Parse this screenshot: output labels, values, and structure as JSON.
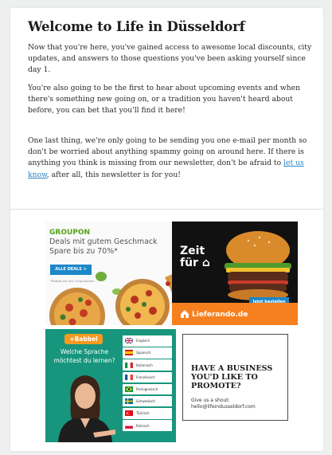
{
  "newsletter": {
    "title": "Welcome to Life in Düsseldorf",
    "p1": "Now that you're here, you've gained access to awesome local discounts, city updates, and answers to those questions you've been asking yourself since day 1.",
    "p2": "You're also going to be the first to hear about upcoming events and when there's something new going on, or a tradition you haven't heard about before, you can bet that you'll find it here!",
    "p3_before": "One last thing, we're only going to be sending you one e-mail per month so don't be worried about anything spammy going on around here. If there is anything you think is missing from our newsletter, don't be afraid to ",
    "p3_link": "let us know",
    "p3_after": ", after all, this newsletter is for you!"
  },
  "ads": {
    "groupon": {
      "brand": "GROUPON",
      "line1": "Deals mit gutem Geschmack",
      "line2": "Spare bis zu 70%*",
      "cta": "ALLE DEALS >",
      "fine_print": "*Rabatt auf den Originalpreis"
    },
    "lieferando": {
      "headline_line1": "Zeit",
      "headline_line2": "für",
      "brand": "Lieferando.de",
      "cta": "Jetzt bestellen"
    },
    "babbel": {
      "brand": "+Babbel",
      "question_line1": "Welche Sprache",
      "question_line2": "möchtest du lernen?",
      "languages": [
        {
          "label": "Englisch",
          "flag": "uk-flag-icon"
        },
        {
          "label": "Spanisch",
          "flag": "spain-flag-icon"
        },
        {
          "label": "Italienisch",
          "flag": "italy-flag-icon"
        },
        {
          "label": "Französisch",
          "flag": "france-flag-icon"
        },
        {
          "label": "Portugiesisch",
          "flag": "brazil-flag-icon"
        },
        {
          "label": "Schwedisch",
          "flag": "sweden-flag-icon"
        },
        {
          "label": "Türkisch",
          "flag": "turkey-flag-icon"
        },
        {
          "label": "Polnisch",
          "flag": "poland-flag-icon"
        }
      ]
    },
    "promote": {
      "title": "HAVE A BUSINESS YOU'D LIKE TO PROMOTE?",
      "subtitle": "Give us a shout:",
      "email": "hello@lifeindusseldorf.com"
    }
  },
  "colors": {
    "link": "#2a86c9",
    "groupon_green": "#53a318",
    "lieferando_orange": "#f7801e",
    "babbel_teal": "#17967d",
    "babbel_orange": "#f39a21"
  }
}
